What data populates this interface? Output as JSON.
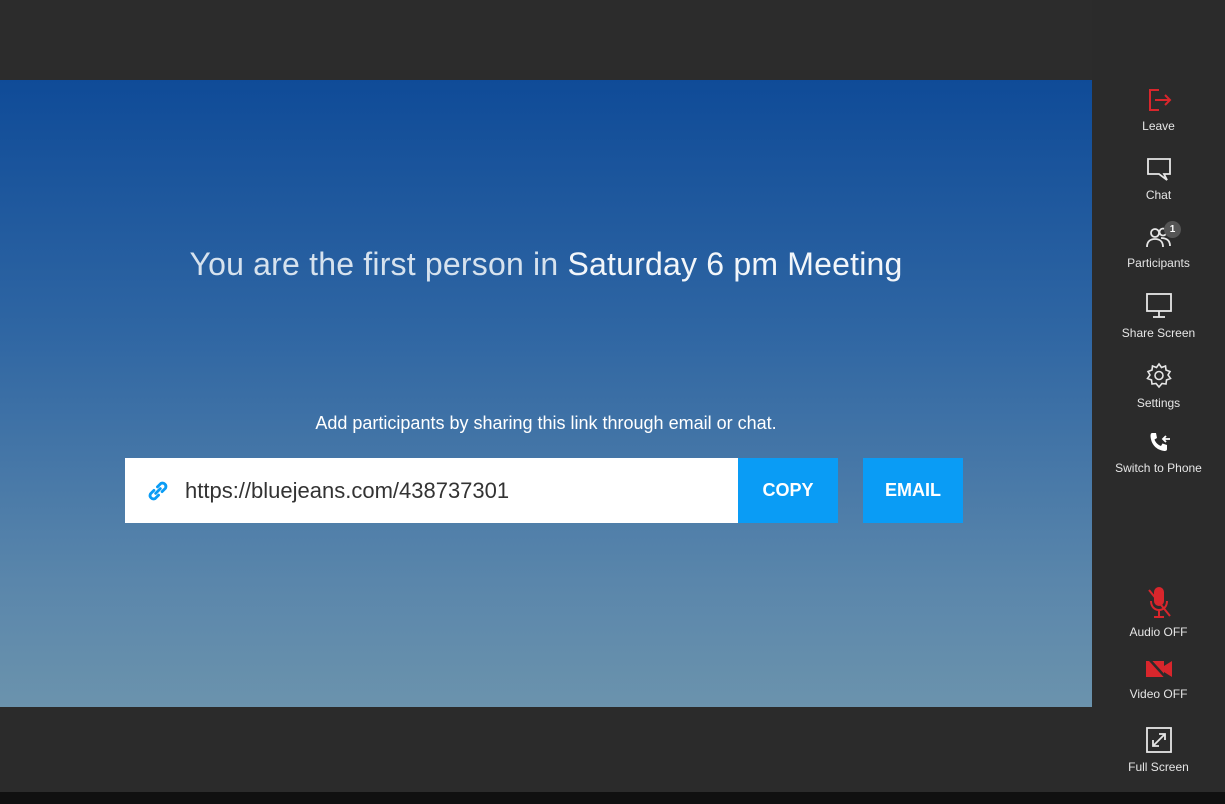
{
  "stage": {
    "headline_prefix": "You are the first person in ",
    "meeting_name": "Saturday 6 pm Meeting",
    "share_instructions": "Add participants by sharing this link through email or chat.",
    "meeting_link": "https://bluejeans.com/438737301",
    "copy_label": "COPY",
    "email_label": "EMAIL"
  },
  "sidebar": {
    "leave": "Leave",
    "chat": "Chat",
    "participants": "Participants",
    "participants_count": "1",
    "share_screen": "Share Screen",
    "settings": "Settings",
    "switch_to_phone": "Switch to Phone",
    "audio": "Audio OFF",
    "video": "Video OFF",
    "full_screen": "Full Screen"
  },
  "colors": {
    "accent": "#0a9cf5",
    "danger": "#d8262c",
    "sidebar_bg": "#2b2b2b"
  },
  "icons": [
    "leave-icon",
    "chat-icon",
    "participants-icon",
    "share-screen-icon",
    "settings-icon",
    "phone-icon",
    "mic-off-icon",
    "video-off-icon",
    "fullscreen-icon",
    "link-icon"
  ]
}
